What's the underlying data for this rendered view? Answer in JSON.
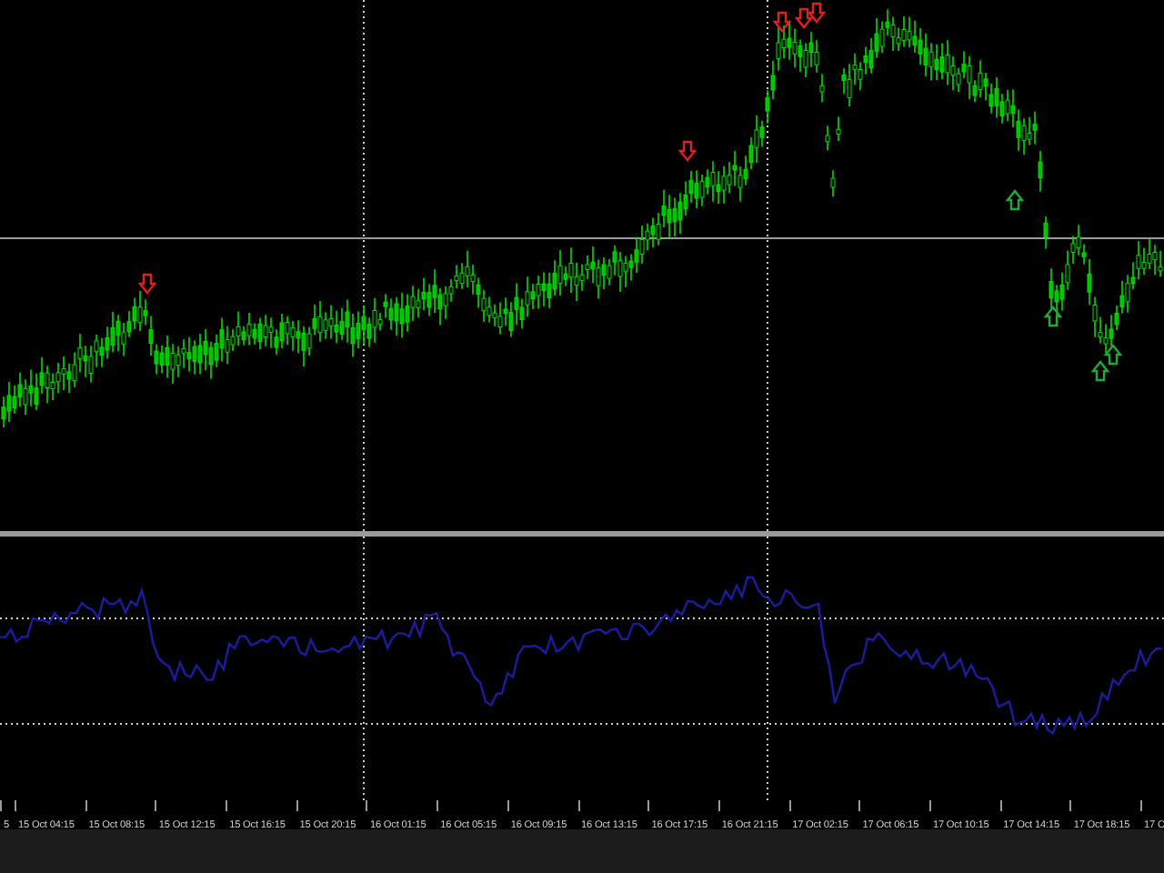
{
  "time_axis": {
    "labels": [
      "5",
      "15 Oct 04:15",
      "15 Oct 08:15",
      "15 Oct 12:15",
      "15 Oct 16:15",
      "15 Oct 20:15",
      "16 Oct 01:15",
      "16 Oct 05:15",
      "16 Oct 09:15",
      "16 Oct 13:15",
      "16 Oct 17:15",
      "16 Oct 21:15",
      "17 Oct 02:15",
      "17 Oct 06:15",
      "17 Oct 10:15",
      "17 Oct 14:15",
      "17 Oct 18:15",
      "17 O"
    ]
  }
}
